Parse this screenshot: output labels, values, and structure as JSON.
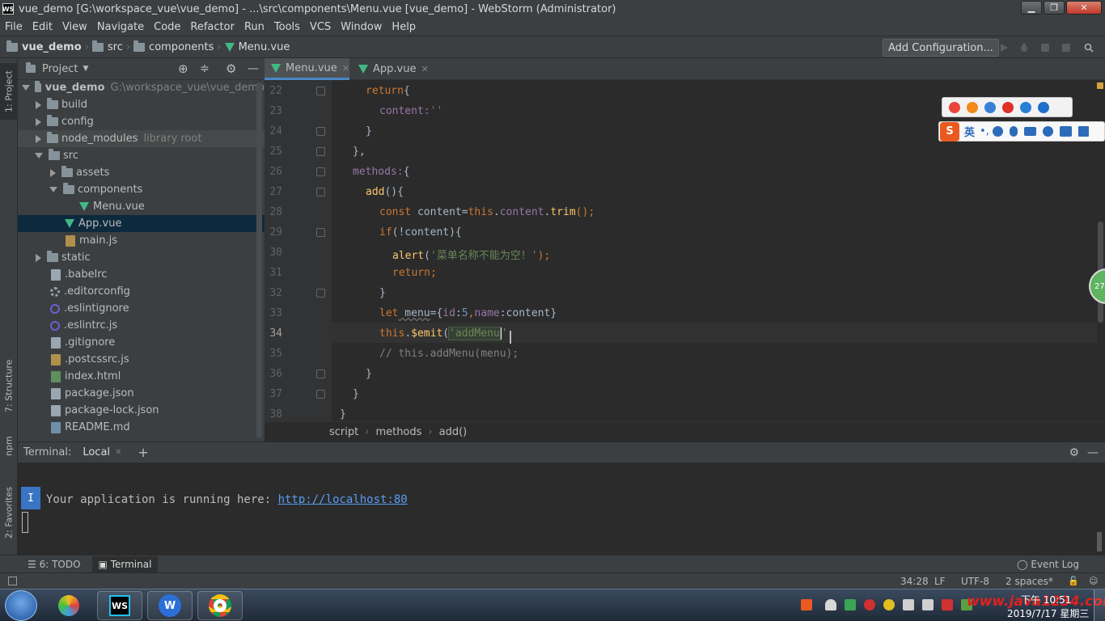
{
  "window": {
    "title": "vue_demo [G:\\workspace_vue\\vue_demo] - ...\\src\\components\\Menu.vue [vue_demo] - WebStorm (Administrator)",
    "min": "▁",
    "max": "❐",
    "close": "✕"
  },
  "menu": [
    "File",
    "Edit",
    "View",
    "Navigate",
    "Code",
    "Refactor",
    "Run",
    "Tools",
    "VCS",
    "Window",
    "Help"
  ],
  "nav": {
    "crumbs": [
      "vue_demo",
      "src",
      "components",
      "Menu.vue"
    ],
    "add_configuration": "Add Configuration..."
  },
  "tool_stripe": {
    "project": "1: Project",
    "structure": "7: Structure",
    "npm": "npm",
    "favorites": "2: Favorites"
  },
  "project_panel": {
    "title": "Project",
    "root": "vue_demo",
    "root_path": "G:\\workspace_vue\\vue_demo",
    "items": [
      {
        "name": "build"
      },
      {
        "name": "config"
      },
      {
        "name": "node_modules",
        "hint": "library root"
      },
      {
        "name": "src"
      },
      {
        "name": "assets"
      },
      {
        "name": "components"
      },
      {
        "name": "Menu.vue"
      },
      {
        "name": "App.vue"
      },
      {
        "name": "main.js"
      },
      {
        "name": "static"
      },
      {
        "name": ".babelrc"
      },
      {
        "name": ".editorconfig"
      },
      {
        "name": ".eslintignore"
      },
      {
        "name": ".eslintrc.js"
      },
      {
        "name": ".gitignore"
      },
      {
        "name": ".postcssrc.js"
      },
      {
        "name": "index.html"
      },
      {
        "name": "package.json"
      },
      {
        "name": "package-lock.json"
      },
      {
        "name": "README.md"
      }
    ]
  },
  "editor": {
    "tabs": [
      "Menu.vue",
      "App.vue"
    ],
    "line_numbers": [
      "22",
      "23",
      "24",
      "25",
      "26",
      "27",
      "28",
      "29",
      "30",
      "31",
      "32",
      "33",
      "34",
      "35",
      "36",
      "37",
      "38"
    ],
    "code": {
      "l22_kw": "return",
      "l22_rest": "{",
      "l23_key": "content:",
      "l23_str": "''",
      "l24": "}",
      "l25": "},",
      "l26_key": "methods:",
      "l26_rest": "{",
      "l27_fn": "add",
      "l27_rest": "(){",
      "l28_kw": "const",
      "l28_var": " content=",
      "l28_this": "this",
      "l28_dot": ".",
      "l28_field": "content",
      "l28_dot2": ".",
      "l28_fn": "trim",
      "l28_end": "();",
      "l29_kw": "if",
      "l29_rest": "(!content){",
      "l30_fn": "alert",
      "l30_open": "(",
      "l30_str": "'菜单名称不能为空！'",
      "l30_end": ");",
      "l31_kw": "return",
      "l31_end": ";",
      "l32": "}",
      "l33_kw": "let",
      "l33_var": " menu",
      "l33_eq": "={",
      "l33_k1": "id",
      "l33_colon1": ":",
      "l33_num": "5",
      "l33_comma": ",",
      "l33_k2": "name",
      "l33_rest": ":content}",
      "l34_this": "this",
      "l34_dot": ".",
      "l34_fn": "$emit",
      "l34_open": "(",
      "l34_str": "'addMenu",
      "l34_end": "'",
      "l35_cmt": "// this.addMenu(menu);",
      "l36": "}",
      "l37": "}",
      "l38": "}"
    },
    "breadcrumb": [
      "script",
      "methods",
      "add()"
    ]
  },
  "ime": {
    "lang": "英",
    "punct": "•,",
    "badge": "27"
  },
  "terminal": {
    "label": "Terminal:",
    "tab": "Local",
    "add": "+",
    "prompt_mark": "I",
    "message": "Your application is running here: ",
    "link": "http://localhost:80"
  },
  "bottom_tabs": {
    "todo": "6: TODO",
    "terminal": "Terminal",
    "event_log": "Event Log"
  },
  "status": {
    "position": "34:28",
    "line_sep": "LF",
    "encoding": "UTF-8",
    "indent": "2 spaces*"
  },
  "taskbar": {
    "time": "下午 10:51",
    "date": "2019/7/17 星期三",
    "watermark": "www.java1234.com",
    "ws_label": "WS"
  }
}
